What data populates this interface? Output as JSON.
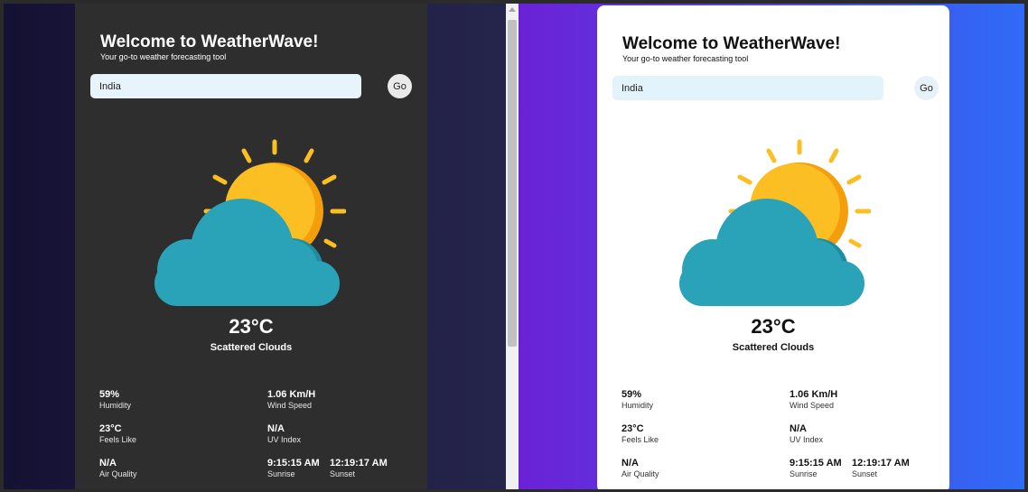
{
  "cards": [
    {
      "theme": "dark",
      "title": "Welcome to WeatherWave!",
      "subtitle": "Your go-to weather forecasting tool",
      "search": {
        "value": "India"
      },
      "go_label": "Go",
      "weather_icon": "sun-behind-cloud-icon",
      "temperature": "23°C",
      "description": "Scattered Clouds",
      "stats": {
        "humidity": {
          "value": "59%",
          "label": "Humidity"
        },
        "wind": {
          "value": "1.06 Km/H",
          "label": "Wind Speed"
        },
        "feels_like": {
          "value": "23°C",
          "label": "Feels Like"
        },
        "uv": {
          "value": "N/A",
          "label": "UV Index"
        },
        "air_quality": {
          "value": "N/A",
          "label": "Air Quality"
        },
        "sunrise": {
          "value": "9:15:15 AM",
          "label": "Sunrise"
        },
        "sunset": {
          "value": "12:19:17 AM",
          "label": "Sunset"
        }
      }
    },
    {
      "theme": "light",
      "title": "Welcome to WeatherWave!",
      "subtitle": "Your go-to weather forecasting tool",
      "search": {
        "value": "India"
      },
      "go_label": "Go",
      "weather_icon": "sun-behind-cloud-icon",
      "temperature": "23°C",
      "description": "Scattered Clouds",
      "stats": {
        "humidity": {
          "value": "59%",
          "label": "Humidity"
        },
        "wind": {
          "value": "1.06 Km/H",
          "label": "Wind Speed"
        },
        "feels_like": {
          "value": "23°C",
          "label": "Feels Like"
        },
        "uv": {
          "value": "N/A",
          "label": "UV Index"
        },
        "air_quality": {
          "value": "N/A",
          "label": "Air Quality"
        },
        "sunrise": {
          "value": "9:15:15 AM",
          "label": "Sunrise"
        },
        "sunset": {
          "value": "12:19:17 AM",
          "label": "Sunset"
        }
      }
    }
  ],
  "colors": {
    "dark_card": "#2e2e2e",
    "light_card": "#ffffff",
    "sun": "#fbbf24",
    "sun_shade": "#f59e0b",
    "cloud": "#2aa3b8",
    "cloud_shade": "#1d8ba0"
  }
}
